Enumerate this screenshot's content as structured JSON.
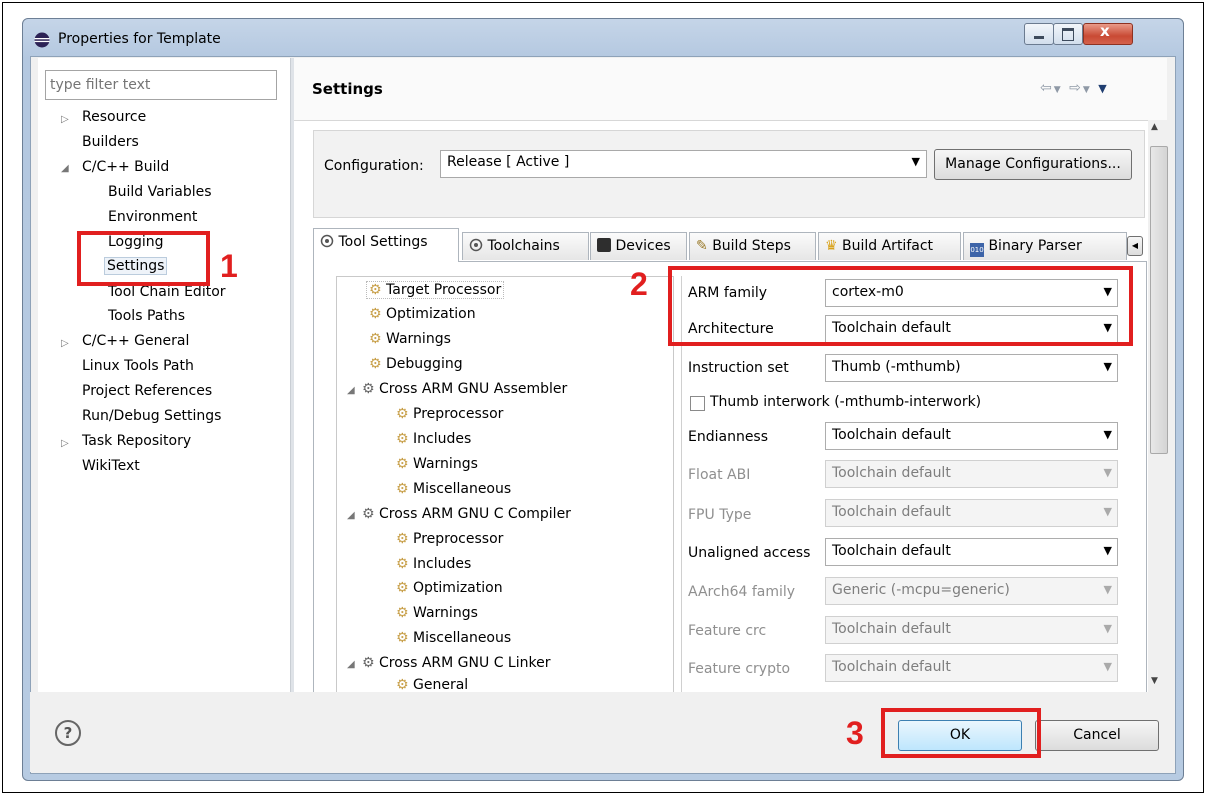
{
  "window": {
    "title": "Properties for Template"
  },
  "filter": {
    "placeholder": "type filter text"
  },
  "nav_tree": [
    {
      "label": "Resource"
    },
    {
      "label": "Builders"
    },
    {
      "label": "C/C++ Build"
    },
    {
      "label": "Build Variables"
    },
    {
      "label": "Environment"
    },
    {
      "label": "Logging"
    },
    {
      "label": "Settings"
    },
    {
      "label": "Tool Chain Editor"
    },
    {
      "label": "Tools Paths"
    },
    {
      "label": "C/C++ General"
    },
    {
      "label": "Linux Tools Path"
    },
    {
      "label": "Project References"
    },
    {
      "label": "Run/Debug Settings"
    },
    {
      "label": "Task Repository"
    },
    {
      "label": "WikiText"
    }
  ],
  "page": {
    "title": "Settings"
  },
  "configuration": {
    "label": "Configuration:",
    "value": "Release  [ Active ]",
    "manage_button": "Manage Configurations..."
  },
  "tabs": [
    {
      "label": "Tool Settings"
    },
    {
      "label": "Toolchains"
    },
    {
      "label": "Devices"
    },
    {
      "label": "Build Steps"
    },
    {
      "label": "Build Artifact"
    },
    {
      "label": "Binary Parser"
    }
  ],
  "tool_tree": [
    {
      "label": "Target Processor"
    },
    {
      "label": "Optimization"
    },
    {
      "label": "Warnings"
    },
    {
      "label": "Debugging"
    },
    {
      "label": "Cross ARM GNU Assembler"
    },
    {
      "label": "Preprocessor"
    },
    {
      "label": "Includes"
    },
    {
      "label": "Warnings"
    },
    {
      "label": "Miscellaneous"
    },
    {
      "label": "Cross ARM GNU C Compiler"
    },
    {
      "label": "Preprocessor"
    },
    {
      "label": "Includes"
    },
    {
      "label": "Optimization"
    },
    {
      "label": "Warnings"
    },
    {
      "label": "Miscellaneous"
    },
    {
      "label": "Cross ARM GNU C Linker"
    },
    {
      "label": "General"
    }
  ],
  "properties": [
    {
      "label": "ARM family",
      "value": "cortex-m0"
    },
    {
      "label": "Architecture",
      "value": "Toolchain default"
    },
    {
      "label": "Instruction set",
      "value": "Thumb (-mthumb)"
    },
    {
      "label": "Thumb interwork (-mthumb-interwork)"
    },
    {
      "label": "Endianness",
      "value": "Toolchain default"
    },
    {
      "label": "Float ABI",
      "value": "Toolchain default"
    },
    {
      "label": "FPU Type",
      "value": "Toolchain default"
    },
    {
      "label": "Unaligned access",
      "value": "Toolchain default"
    },
    {
      "label": "AArch64 family",
      "value": "Generic (-mcpu=generic)"
    },
    {
      "label": "Feature crc",
      "value": "Toolchain default"
    },
    {
      "label": "Feature crypto",
      "value": "Toolchain default"
    }
  ],
  "buttons": {
    "ok": "OK",
    "cancel": "Cancel",
    "help": "?"
  },
  "annotations": {
    "one": "1",
    "two": "2",
    "three": "3"
  },
  "colors": {
    "highlight": "#e11f1f"
  }
}
